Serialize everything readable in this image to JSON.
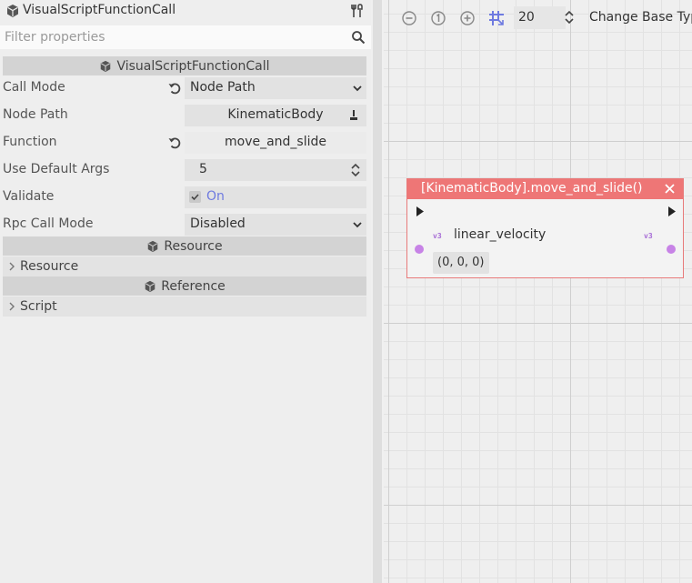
{
  "inspector": {
    "title": "VisualScriptFunctionCall",
    "filter_placeholder": "Filter properties",
    "section_title": "VisualScriptFunctionCall",
    "properties": {
      "call_mode": {
        "label": "Call Mode",
        "value": "Node Path"
      },
      "node_path": {
        "label": "Node Path",
        "value": "KinematicBody"
      },
      "function": {
        "label": "Function",
        "value": "move_and_slide"
      },
      "use_default_args": {
        "label": "Use Default Args",
        "value": "5"
      },
      "validate": {
        "label": "Validate",
        "value": "On"
      },
      "rpc_call_mode": {
        "label": "Rpc Call Mode",
        "value": "Disabled"
      }
    },
    "resource_section": "Resource",
    "resource_item": "Resource",
    "reference_section": "Reference",
    "script_item": "Script"
  },
  "graph": {
    "snap_value": "20",
    "change_base_type_label": "Change Base Type",
    "node": {
      "title": "[KinematicBody].move_and_slide()",
      "input_port_label": "linear_velocity",
      "input_port_value": "(0, 0, 0)",
      "port_type_tag": "v3"
    }
  },
  "colors": {
    "node_header": "#ee7676",
    "port": "#c783e6",
    "toggle_on": "#6e7ae0"
  }
}
